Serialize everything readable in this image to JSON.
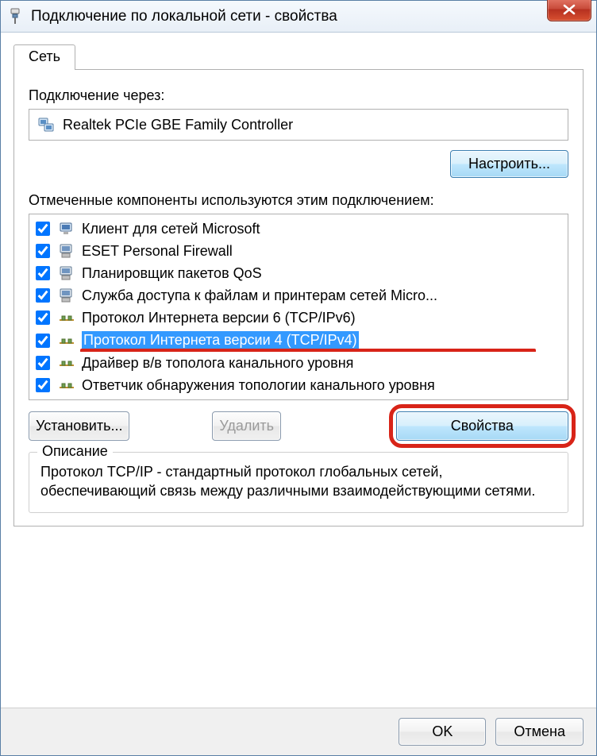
{
  "window": {
    "title": "Подключение по локальной сети - свойства"
  },
  "tab": {
    "label": "Сеть"
  },
  "connect_via_label": "Подключение через:",
  "adapter_name": "Realtek PCIe GBE Family Controller",
  "configure_btn": "Настроить...",
  "components_label": "Отмеченные компоненты используются этим подключением:",
  "components": [
    {
      "label": "Клиент для сетей Microsoft",
      "icon": "client",
      "checked": true,
      "selected": false,
      "underline": false
    },
    {
      "label": "ESET Personal Firewall",
      "icon": "service",
      "checked": true,
      "selected": false,
      "underline": false
    },
    {
      "label": "Планировщик пакетов QoS",
      "icon": "service",
      "checked": true,
      "selected": false,
      "underline": false
    },
    {
      "label": "Служба доступа к файлам и принтерам сетей Micro...",
      "icon": "service",
      "checked": true,
      "selected": false,
      "underline": false
    },
    {
      "label": "Протокол Интернета версии 6 (TCP/IPv6)",
      "icon": "protocol",
      "checked": true,
      "selected": false,
      "underline": false
    },
    {
      "label": "Протокол Интернета версии 4 (TCP/IPv4)",
      "icon": "protocol",
      "checked": true,
      "selected": true,
      "underline": true
    },
    {
      "label": "Драйвер в/в тополога канального уровня",
      "icon": "protocol",
      "checked": true,
      "selected": false,
      "underline": false
    },
    {
      "label": "Ответчик обнаружения топологии канального уровня",
      "icon": "protocol",
      "checked": true,
      "selected": false,
      "underline": false
    }
  ],
  "buttons": {
    "install": "Установить...",
    "uninstall": "Удалить",
    "properties": "Свойства"
  },
  "description": {
    "title": "Описание",
    "text": "Протокол TCP/IP - стандартный протокол глобальных сетей, обеспечивающий связь между различными взаимодействующими сетями."
  },
  "footer": {
    "ok": "OK",
    "cancel": "Отмена"
  }
}
